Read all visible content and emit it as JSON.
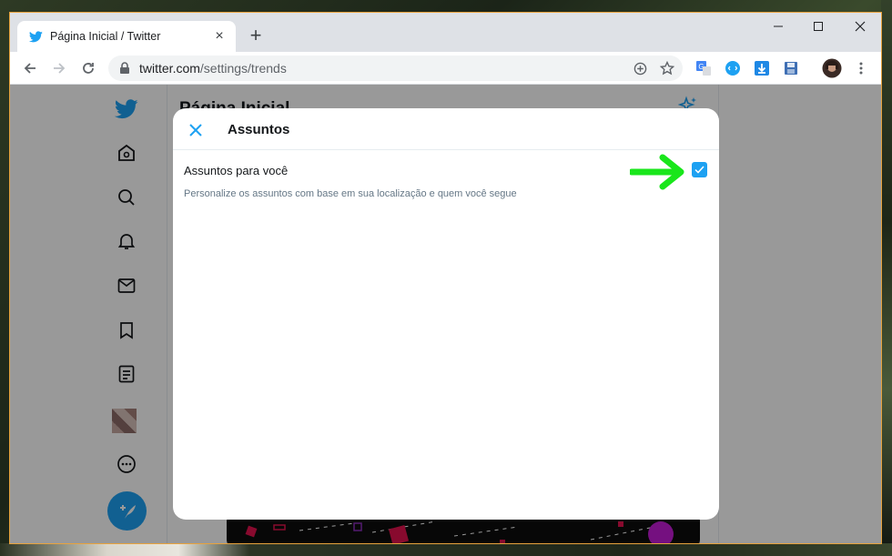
{
  "browser": {
    "tab_title": "Página Inicial / Twitter",
    "url_host": "twitter.com",
    "url_path": "/settings/trends"
  },
  "page": {
    "header_title": "Página Inicial"
  },
  "modal": {
    "title": "Assuntos",
    "setting_label": "Assuntos para você",
    "setting_description": "Personalize os assuntos com base em sua localização e quem você segue",
    "checkbox_checked": true
  },
  "colors": {
    "twitter_blue": "#1da1f2",
    "annotation_arrow": "#19e61b"
  }
}
